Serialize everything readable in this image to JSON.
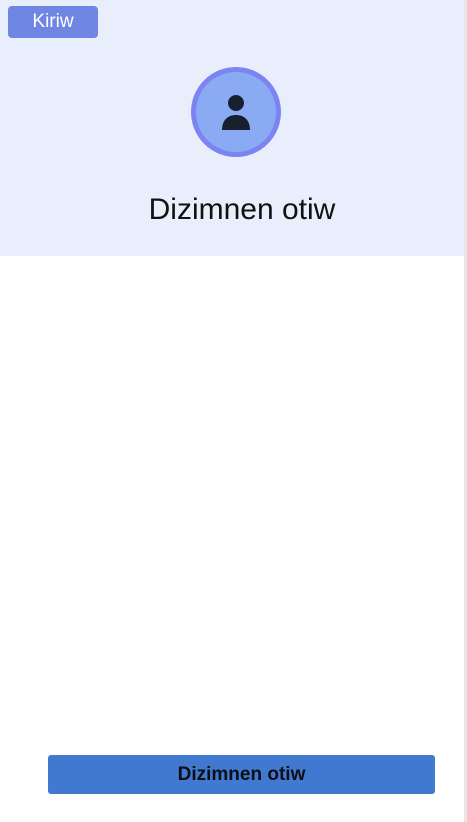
{
  "header": {
    "login_button_label": "Kiriw",
    "title": "Dizimnen otiw",
    "avatar_icon": "person-icon"
  },
  "footer": {
    "primary_button_label": "Dizimnen otiw"
  },
  "colors": {
    "header_background": "#e8eefb",
    "login_button": "#6f86e3",
    "avatar_fill": "#8aaaf3",
    "avatar_border": "#7d84f2",
    "primary_button": "#4179d1"
  }
}
